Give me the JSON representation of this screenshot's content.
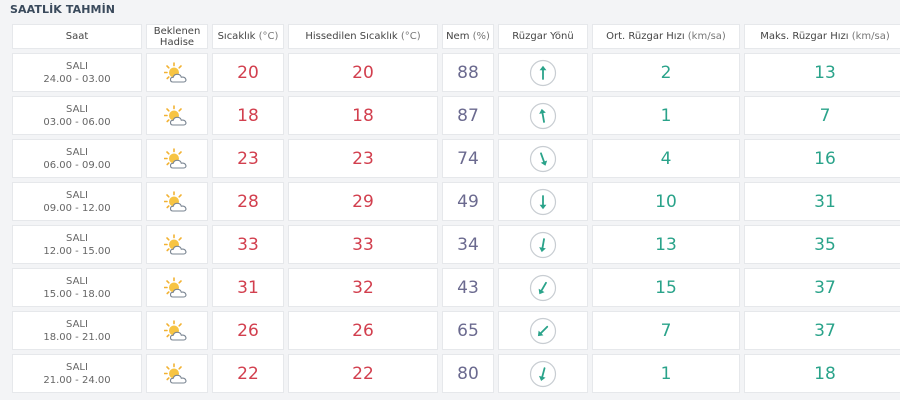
{
  "title": "SAATLİK TAHMİN",
  "headers": {
    "saat": "Saat",
    "hadise_line1": "Beklenen",
    "hadise_line2": "Hadise",
    "sicaklik": "Sıcaklık",
    "sicaklik_unit": "(°C)",
    "hissedilen": "Hissedilen Sıcaklık",
    "hissedilen_unit": "(°C)",
    "nem": "Nem",
    "nem_unit": "(%)",
    "ruzgar_yonu": "Rüzgar Yönü",
    "ort_hiz": "Ort. Rüzgar Hızı",
    "ort_hiz_unit": "(km/sa)",
    "maks_hiz": "Maks. Rüzgar Hızı",
    "maks_hiz_unit": "(km/sa)"
  },
  "rows": [
    {
      "day": "SALI",
      "time": "24.00 - 03.00",
      "icon": "partly-cloudy-icon",
      "temp": "20",
      "feels": "20",
      "humidity": "88",
      "wind_dir_deg": 0,
      "avg_wind": "2",
      "max_wind": "13"
    },
    {
      "day": "SALI",
      "time": "03.00 - 06.00",
      "icon": "partly-cloudy-icon",
      "temp": "18",
      "feels": "18",
      "humidity": "87",
      "wind_dir_deg": 350,
      "avg_wind": "1",
      "max_wind": "7"
    },
    {
      "day": "SALI",
      "time": "06.00 - 09.00",
      "icon": "partly-cloudy-icon",
      "temp": "23",
      "feels": "23",
      "humidity": "74",
      "wind_dir_deg": 160,
      "avg_wind": "4",
      "max_wind": "16"
    },
    {
      "day": "SALI",
      "time": "09.00 - 12.00",
      "icon": "partly-cloudy-icon",
      "temp": "28",
      "feels": "29",
      "humidity": "49",
      "wind_dir_deg": 180,
      "avg_wind": "10",
      "max_wind": "31"
    },
    {
      "day": "SALI",
      "time": "12.00 - 15.00",
      "icon": "partly-cloudy-icon",
      "temp": "33",
      "feels": "33",
      "humidity": "34",
      "wind_dir_deg": 190,
      "avg_wind": "13",
      "max_wind": "35"
    },
    {
      "day": "SALI",
      "time": "15.00 - 18.00",
      "icon": "partly-cloudy-icon",
      "temp": "31",
      "feels": "32",
      "humidity": "43",
      "wind_dir_deg": 210,
      "avg_wind": "15",
      "max_wind": "37"
    },
    {
      "day": "SALI",
      "time": "18.00 - 21.00",
      "icon": "partly-cloudy-icon",
      "temp": "26",
      "feels": "26",
      "humidity": "65",
      "wind_dir_deg": 225,
      "avg_wind": "7",
      "max_wind": "37"
    },
    {
      "day": "SALI",
      "time": "21.00 - 24.00",
      "icon": "partly-cloudy-icon",
      "temp": "22",
      "feels": "22",
      "humidity": "80",
      "wind_dir_deg": 195,
      "avg_wind": "1",
      "max_wind": "18"
    }
  ],
  "colors": {
    "temperature": "#d23f4e",
    "humidity": "#6b6a8f",
    "wind": "#2aa38a",
    "title": "#3a4a5c"
  }
}
